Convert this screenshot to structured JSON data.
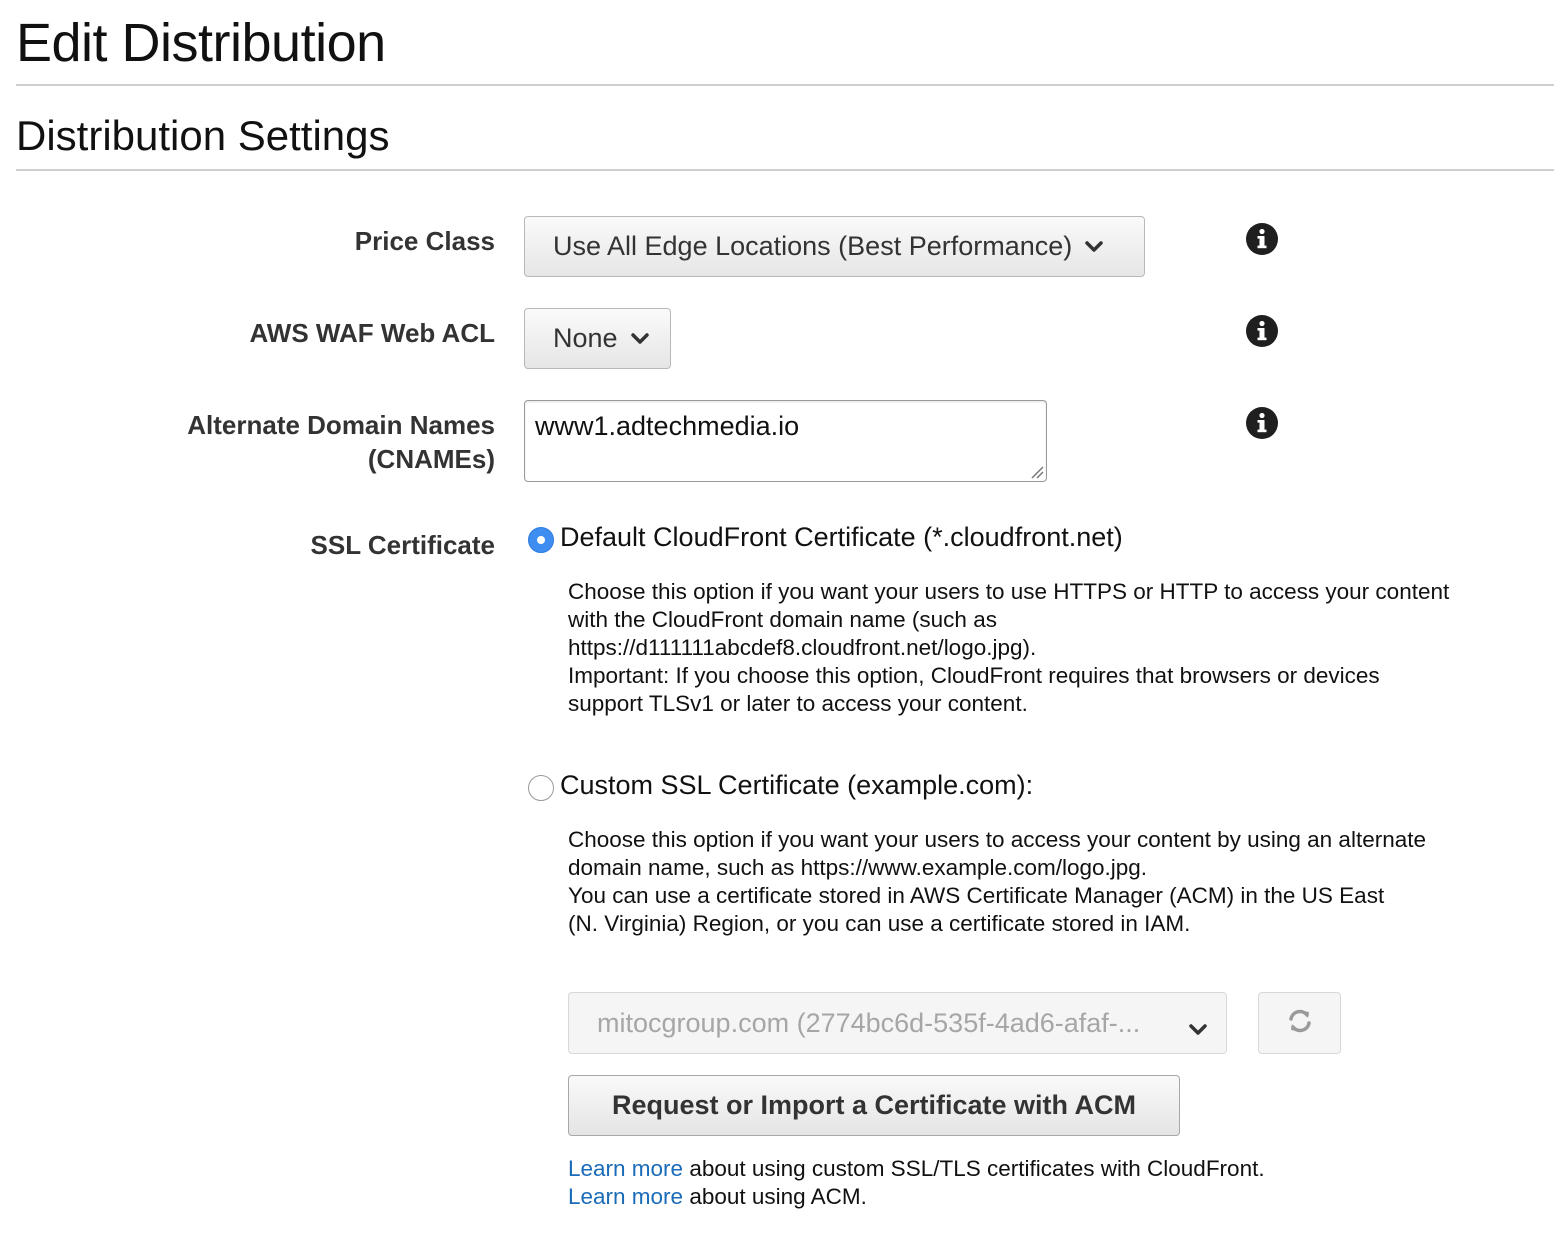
{
  "page": {
    "title": "Edit Distribution"
  },
  "section": {
    "title": "Distribution Settings"
  },
  "price_class": {
    "label": "Price Class",
    "selected": "Use All Edge Locations (Best Performance)"
  },
  "waf": {
    "label": "AWS WAF Web ACL",
    "selected": "None"
  },
  "cnames": {
    "label_line1": "Alternate Domain Names",
    "label_line2": "(CNAMEs)",
    "value": "www1.adtechmedia.io"
  },
  "ssl": {
    "label": "SSL Certificate",
    "default_option": {
      "label": "Default CloudFront Certificate (*.cloudfront.net)",
      "checked": true,
      "description": [
        "Choose this option if you want your users to use HTTPS or HTTP to access your content",
        "with the CloudFront domain name (such as",
        "https://d111111abcdef8.cloudfront.net/logo.jpg).",
        "Important: If you choose this option, CloudFront requires that browsers or devices",
        "support TLSv1 or later to access your content."
      ]
    },
    "custom_option": {
      "label": "Custom SSL Certificate (example.com):",
      "checked": false,
      "description": [
        "Choose this option if you want your users to access your content by using an alternate",
        "domain name, such as https://www.example.com/logo.jpg.",
        "You can use a certificate stored in AWS Certificate Manager (ACM) in the US East",
        "(N. Virginia) Region, or you can use a certificate stored in IAM."
      ]
    },
    "certificate_select": "mitocgroup.com (2774bc6d-535f-4ad6-afaf-...",
    "acm_button": "Request or Import a Certificate with ACM",
    "learn_more_1": {
      "link": "Learn more",
      "text": " about using custom SSL/TLS certificates with CloudFront."
    },
    "learn_more_2": {
      "link": "Learn more",
      "text": " about using ACM."
    }
  },
  "icons": {
    "info": "info-icon",
    "chevron": "chevron-down-icon",
    "refresh": "refresh-icon"
  },
  "colors": {
    "radio_selected": "#3d8ef0",
    "link": "#1a6bb8"
  }
}
